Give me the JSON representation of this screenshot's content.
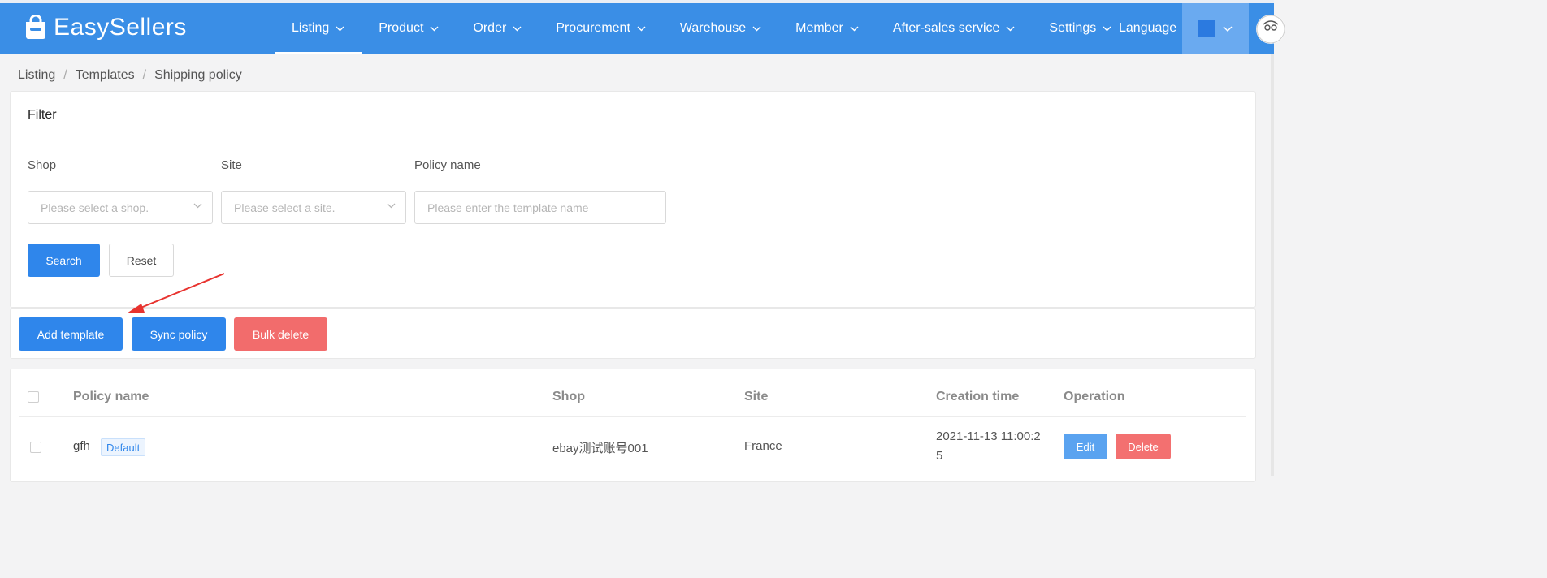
{
  "brand": {
    "name": "EasySellers"
  },
  "nav": {
    "items": [
      {
        "label": "Listing",
        "active": true
      },
      {
        "label": "Product"
      },
      {
        "label": "Order"
      },
      {
        "label": "Procurement"
      },
      {
        "label": "Warehouse"
      },
      {
        "label": "Member"
      },
      {
        "label": "After-sales service"
      },
      {
        "label": "Settings"
      }
    ],
    "language_label": "Language"
  },
  "breadcrumb": [
    "Listing",
    "Templates",
    "Shipping policy"
  ],
  "filter": {
    "title": "Filter",
    "shop_label": "Shop",
    "shop_placeholder": "Please select a shop.",
    "site_label": "Site",
    "site_placeholder": "Please select a site.",
    "policy_label": "Policy name",
    "policy_placeholder": "Please enter the template name",
    "search_label": "Search",
    "reset_label": "Reset"
  },
  "actions": {
    "add_label": "Add template",
    "sync_label": "Sync policy",
    "bulk_delete_label": "Bulk delete"
  },
  "table": {
    "columns": [
      "Policy name",
      "Shop",
      "Site",
      "Creation time",
      "Operation"
    ],
    "rows": [
      {
        "policy_name": "gfh",
        "tag": "Default",
        "shop": "ebay测试账号001",
        "site": "France",
        "creation_time_line1": "2021-11-13 11:00:2",
        "creation_time_line2": "5",
        "edit_label": "Edit",
        "delete_label": "Delete"
      }
    ]
  },
  "colors": {
    "header_bg": "#3a8ee6",
    "primary": "#2f86eb",
    "danger": "#f26c6c",
    "annotation_arrow": "#e8332f"
  }
}
